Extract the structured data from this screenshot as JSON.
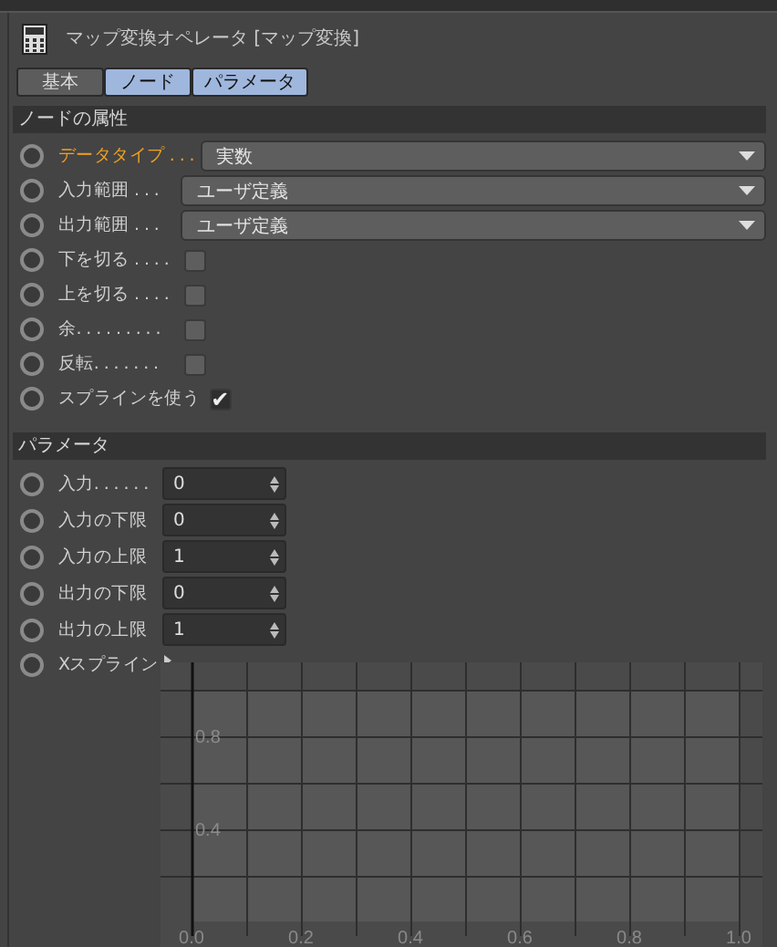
{
  "title": "マップ変換オペレータ [マップ変換]",
  "tabs": [
    {
      "label": "基本",
      "selected": false
    },
    {
      "label": "ノード",
      "selected": true
    },
    {
      "label": "パラメータ",
      "selected": true
    }
  ],
  "sections": [
    {
      "title": "ノードの属性",
      "rows": [
        {
          "kind": "dropdown",
          "label": "データタイプ . . .",
          "highlighted": true,
          "value": "実数"
        },
        {
          "kind": "dropdown",
          "label": "入力範囲 . . .",
          "highlighted": false,
          "value": "ユーザ定義"
        },
        {
          "kind": "dropdown",
          "label": "出力範囲 . . .",
          "highlighted": false,
          "value": "ユーザ定義"
        },
        {
          "kind": "checkbox",
          "label": "下を切る . . . .",
          "highlighted": false,
          "checked": false
        },
        {
          "kind": "checkbox",
          "label": "上を切る . . . .",
          "highlighted": false,
          "checked": false
        },
        {
          "kind": "checkbox",
          "label": "余. . . . . . . . .",
          "highlighted": false,
          "checked": false
        },
        {
          "kind": "checkbox",
          "label": "反転. . . . . . .",
          "highlighted": false,
          "checked": false
        },
        {
          "kind": "checkbox",
          "label": "スプラインを使う",
          "highlighted": false,
          "checked": true,
          "mark": "✔"
        }
      ]
    },
    {
      "title": "パラメータ",
      "rows": [
        {
          "kind": "number",
          "label": "入力. . . . . .",
          "highlighted": false,
          "value": "0"
        },
        {
          "kind": "number",
          "label": "入力の下限",
          "highlighted": false,
          "value": "0"
        },
        {
          "kind": "number",
          "label": "入力の上限",
          "highlighted": false,
          "value": "1"
        },
        {
          "kind": "number",
          "label": "出力の下限",
          "highlighted": false,
          "value": "0"
        },
        {
          "kind": "number",
          "label": "出力の上限",
          "highlighted": false,
          "value": "1"
        },
        {
          "kind": "spline",
          "label": "Xスプライン",
          "highlighted": false,
          "y_ticks": [
            "0.8",
            "0.4"
          ],
          "x_ticks": [
            "0.0",
            "0.2",
            "0.4",
            "0.6",
            "0.8",
            "1.0"
          ]
        }
      ]
    }
  ]
}
